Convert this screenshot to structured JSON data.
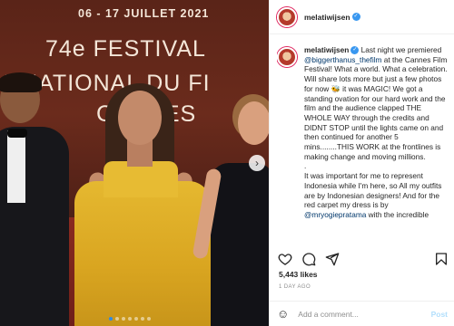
{
  "photo": {
    "banner_date": "06 - 17 JUILLET 2021",
    "banner_line1": "74e FESTIVAL",
    "banner_line2": "RNATIONAL DU FI",
    "banner_line3": "CANNES",
    "carousel_dots": 7,
    "active_dot": 0
  },
  "header": {
    "username": "melatiwijsen"
  },
  "post": {
    "username": "melatiwijsen",
    "caption_p1_a": " Last night we premiered ",
    "mention1": "@biggerthanus_thefilm",
    "caption_p1_b": " at the Cannes Film Festival! What a world. What a celebration. Will share lots more but just a few photos for now 🐝 it was MAGIC! We got a standing ovation for our hard work and the film and the audience clapped THE WHOLE WAY through the credits and DIDNT STOP until the lights came on and then continued for another 5 mins........THIS WORK at the frontlines is making change and moving millions.",
    "caption_p2": ".",
    "caption_p3_a": "It was important for me to represent Indonesia while I'm here, so All my outfits are by Indonesian designers! And for the red carpet my dress is by ",
    "mention2": "@mryogiepratama",
    "caption_p3_b": " with the incredible",
    "likes": "5,443 likes",
    "time_ago": "1 DAY AGO"
  },
  "comment": {
    "placeholder": "Add a comment...",
    "post_label": "Post"
  },
  "icons": {
    "like": "heart-icon",
    "comment": "comment-icon",
    "share": "paper-plane-icon",
    "save": "bookmark-icon",
    "emoji": "smiley-icon",
    "next": "chevron-right-icon"
  },
  "colors": {
    "verified": "#3897f0",
    "mention": "#00376b",
    "post_disabled": "#b2dffc"
  }
}
